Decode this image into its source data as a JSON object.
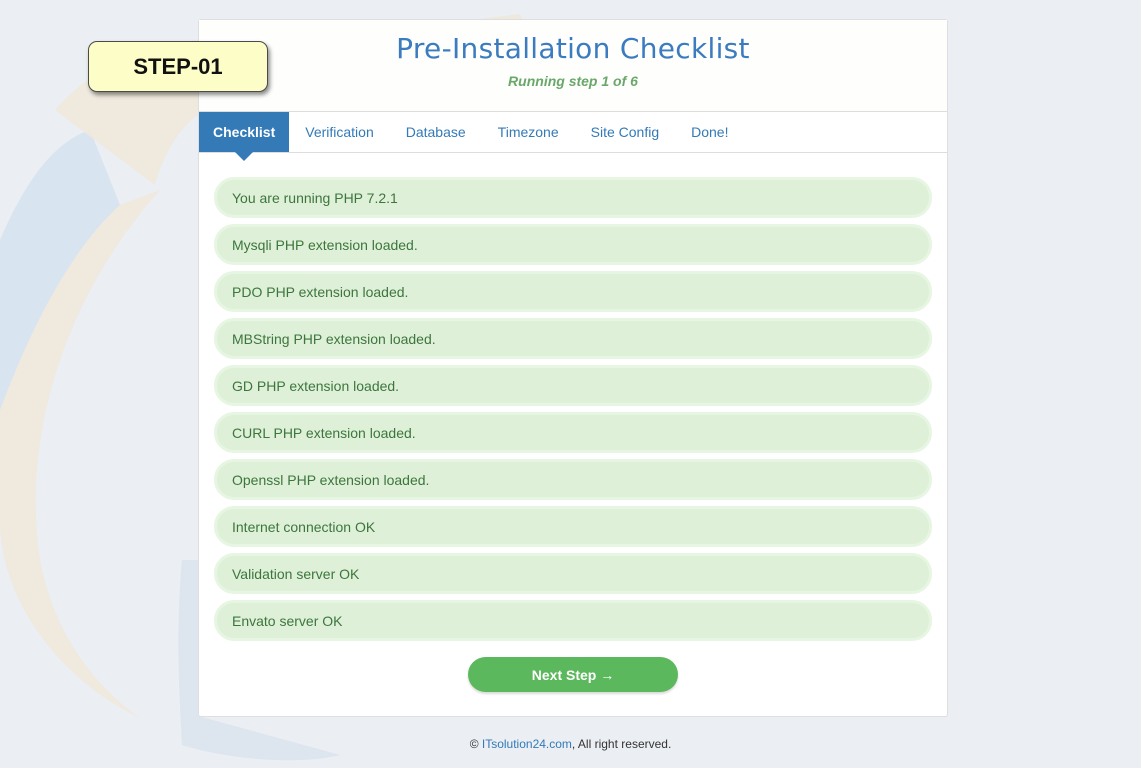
{
  "badge": {
    "label": "STEP-01"
  },
  "header": {
    "title": "Pre-Installation Checklist",
    "subtitle": "Running step 1 of 6"
  },
  "tabs": [
    {
      "label": "Checklist",
      "active": true
    },
    {
      "label": "Verification",
      "active": false
    },
    {
      "label": "Database",
      "active": false
    },
    {
      "label": "Timezone",
      "active": false
    },
    {
      "label": "Site Config",
      "active": false
    },
    {
      "label": "Done!",
      "active": false
    }
  ],
  "checklist": [
    "You are running PHP 7.2.1",
    "Mysqli PHP extension loaded.",
    "PDO PHP extension loaded.",
    "MBString PHP extension loaded.",
    "GD PHP extension loaded.",
    "CURL PHP extension loaded.",
    "Openssl PHP extension loaded.",
    "Internet connection OK",
    "Validation server OK",
    "Envato server OK"
  ],
  "actions": {
    "next_label": "Next Step →"
  },
  "footer": {
    "copyright": "©",
    "link_text": "ITsolution24.com",
    "suffix": ", All right reserved."
  },
  "colors": {
    "accent": "#337ab7",
    "success_bg": "#dff0d8",
    "success_text": "#3c763d",
    "button": "#5cb85c",
    "badge_bg": "#fdfdc8"
  }
}
